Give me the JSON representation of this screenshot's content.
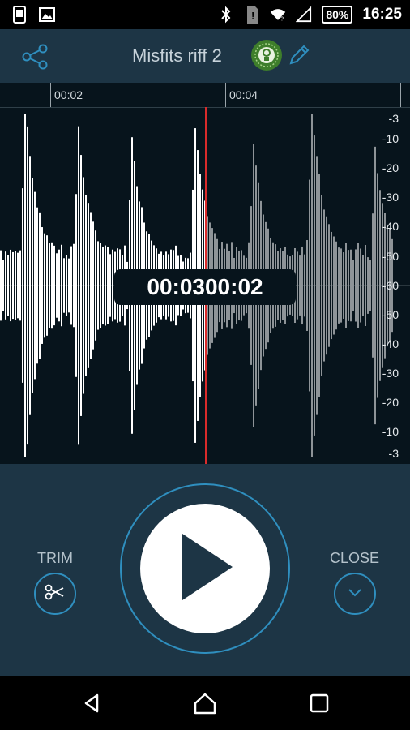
{
  "status_bar": {
    "battery": "80%",
    "time": "16:25"
  },
  "toolbar": {
    "title": "Misfits riff 2"
  },
  "timeline": {
    "ticks": [
      "00:02",
      "00:04"
    ]
  },
  "db_scale": [
    "-3",
    "-10",
    "-20",
    "-30",
    "-40",
    "-50",
    "-60",
    "-50",
    "-40",
    "-30",
    "-20",
    "-10",
    "-3"
  ],
  "overlay_time": "00:0300:02",
  "controls": {
    "trim_label": "TRIM",
    "close_label": "CLOSE"
  },
  "colors": {
    "toolbar_bg": "#1d3545",
    "waveform_bg": "#07141c",
    "played_wave": "#ffffff",
    "unplayed_wave": "#8e9498",
    "playhead": "#d92b2b",
    "accent_ring": "#2f8fbf"
  },
  "icons": [
    "share-icon",
    "badge-icon",
    "edit-icon",
    "play-icon",
    "scissors-icon",
    "chevron-down-icon",
    "back-icon",
    "home-icon",
    "recents-icon"
  ]
}
